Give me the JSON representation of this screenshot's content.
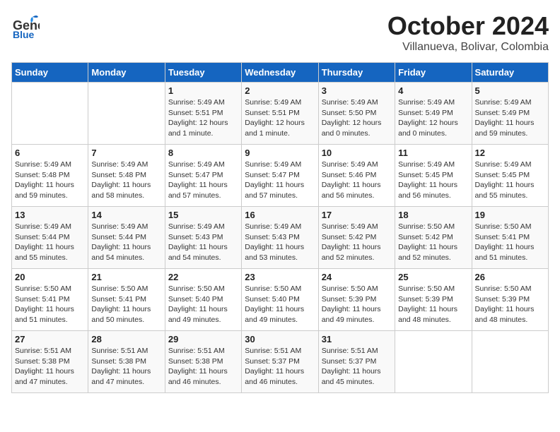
{
  "header": {
    "logo_line1": "General",
    "logo_line2": "Blue",
    "month": "October 2024",
    "location": "Villanueva, Bolivar, Colombia"
  },
  "weekdays": [
    "Sunday",
    "Monday",
    "Tuesday",
    "Wednesday",
    "Thursday",
    "Friday",
    "Saturday"
  ],
  "weeks": [
    [
      {
        "day": "",
        "sunrise": "",
        "sunset": "",
        "daylight": ""
      },
      {
        "day": "",
        "sunrise": "",
        "sunset": "",
        "daylight": ""
      },
      {
        "day": "1",
        "sunrise": "Sunrise: 5:49 AM",
        "sunset": "Sunset: 5:51 PM",
        "daylight": "Daylight: 12 hours and 1 minute."
      },
      {
        "day": "2",
        "sunrise": "Sunrise: 5:49 AM",
        "sunset": "Sunset: 5:51 PM",
        "daylight": "Daylight: 12 hours and 1 minute."
      },
      {
        "day": "3",
        "sunrise": "Sunrise: 5:49 AM",
        "sunset": "Sunset: 5:50 PM",
        "daylight": "Daylight: 12 hours and 0 minutes."
      },
      {
        "day": "4",
        "sunrise": "Sunrise: 5:49 AM",
        "sunset": "Sunset: 5:49 PM",
        "daylight": "Daylight: 12 hours and 0 minutes."
      },
      {
        "day": "5",
        "sunrise": "Sunrise: 5:49 AM",
        "sunset": "Sunset: 5:49 PM",
        "daylight": "Daylight: 11 hours and 59 minutes."
      }
    ],
    [
      {
        "day": "6",
        "sunrise": "Sunrise: 5:49 AM",
        "sunset": "Sunset: 5:48 PM",
        "daylight": "Daylight: 11 hours and 59 minutes."
      },
      {
        "day": "7",
        "sunrise": "Sunrise: 5:49 AM",
        "sunset": "Sunset: 5:48 PM",
        "daylight": "Daylight: 11 hours and 58 minutes."
      },
      {
        "day": "8",
        "sunrise": "Sunrise: 5:49 AM",
        "sunset": "Sunset: 5:47 PM",
        "daylight": "Daylight: 11 hours and 57 minutes."
      },
      {
        "day": "9",
        "sunrise": "Sunrise: 5:49 AM",
        "sunset": "Sunset: 5:47 PM",
        "daylight": "Daylight: 11 hours and 57 minutes."
      },
      {
        "day": "10",
        "sunrise": "Sunrise: 5:49 AM",
        "sunset": "Sunset: 5:46 PM",
        "daylight": "Daylight: 11 hours and 56 minutes."
      },
      {
        "day": "11",
        "sunrise": "Sunrise: 5:49 AM",
        "sunset": "Sunset: 5:45 PM",
        "daylight": "Daylight: 11 hours and 56 minutes."
      },
      {
        "day": "12",
        "sunrise": "Sunrise: 5:49 AM",
        "sunset": "Sunset: 5:45 PM",
        "daylight": "Daylight: 11 hours and 55 minutes."
      }
    ],
    [
      {
        "day": "13",
        "sunrise": "Sunrise: 5:49 AM",
        "sunset": "Sunset: 5:44 PM",
        "daylight": "Daylight: 11 hours and 55 minutes."
      },
      {
        "day": "14",
        "sunrise": "Sunrise: 5:49 AM",
        "sunset": "Sunset: 5:44 PM",
        "daylight": "Daylight: 11 hours and 54 minutes."
      },
      {
        "day": "15",
        "sunrise": "Sunrise: 5:49 AM",
        "sunset": "Sunset: 5:43 PM",
        "daylight": "Daylight: 11 hours and 54 minutes."
      },
      {
        "day": "16",
        "sunrise": "Sunrise: 5:49 AM",
        "sunset": "Sunset: 5:43 PM",
        "daylight": "Daylight: 11 hours and 53 minutes."
      },
      {
        "day": "17",
        "sunrise": "Sunrise: 5:49 AM",
        "sunset": "Sunset: 5:42 PM",
        "daylight": "Daylight: 11 hours and 52 minutes."
      },
      {
        "day": "18",
        "sunrise": "Sunrise: 5:50 AM",
        "sunset": "Sunset: 5:42 PM",
        "daylight": "Daylight: 11 hours and 52 minutes."
      },
      {
        "day": "19",
        "sunrise": "Sunrise: 5:50 AM",
        "sunset": "Sunset: 5:41 PM",
        "daylight": "Daylight: 11 hours and 51 minutes."
      }
    ],
    [
      {
        "day": "20",
        "sunrise": "Sunrise: 5:50 AM",
        "sunset": "Sunset: 5:41 PM",
        "daylight": "Daylight: 11 hours and 51 minutes."
      },
      {
        "day": "21",
        "sunrise": "Sunrise: 5:50 AM",
        "sunset": "Sunset: 5:41 PM",
        "daylight": "Daylight: 11 hours and 50 minutes."
      },
      {
        "day": "22",
        "sunrise": "Sunrise: 5:50 AM",
        "sunset": "Sunset: 5:40 PM",
        "daylight": "Daylight: 11 hours and 49 minutes."
      },
      {
        "day": "23",
        "sunrise": "Sunrise: 5:50 AM",
        "sunset": "Sunset: 5:40 PM",
        "daylight": "Daylight: 11 hours and 49 minutes."
      },
      {
        "day": "24",
        "sunrise": "Sunrise: 5:50 AM",
        "sunset": "Sunset: 5:39 PM",
        "daylight": "Daylight: 11 hours and 49 minutes."
      },
      {
        "day": "25",
        "sunrise": "Sunrise: 5:50 AM",
        "sunset": "Sunset: 5:39 PM",
        "daylight": "Daylight: 11 hours and 48 minutes."
      },
      {
        "day": "26",
        "sunrise": "Sunrise: 5:50 AM",
        "sunset": "Sunset: 5:39 PM",
        "daylight": "Daylight: 11 hours and 48 minutes."
      }
    ],
    [
      {
        "day": "27",
        "sunrise": "Sunrise: 5:51 AM",
        "sunset": "Sunset: 5:38 PM",
        "daylight": "Daylight: 11 hours and 47 minutes."
      },
      {
        "day": "28",
        "sunrise": "Sunrise: 5:51 AM",
        "sunset": "Sunset: 5:38 PM",
        "daylight": "Daylight: 11 hours and 47 minutes."
      },
      {
        "day": "29",
        "sunrise": "Sunrise: 5:51 AM",
        "sunset": "Sunset: 5:38 PM",
        "daylight": "Daylight: 11 hours and 46 minutes."
      },
      {
        "day": "30",
        "sunrise": "Sunrise: 5:51 AM",
        "sunset": "Sunset: 5:37 PM",
        "daylight": "Daylight: 11 hours and 46 minutes."
      },
      {
        "day": "31",
        "sunrise": "Sunrise: 5:51 AM",
        "sunset": "Sunset: 5:37 PM",
        "daylight": "Daylight: 11 hours and 45 minutes."
      },
      {
        "day": "",
        "sunrise": "",
        "sunset": "",
        "daylight": ""
      },
      {
        "day": "",
        "sunrise": "",
        "sunset": "",
        "daylight": ""
      }
    ]
  ]
}
